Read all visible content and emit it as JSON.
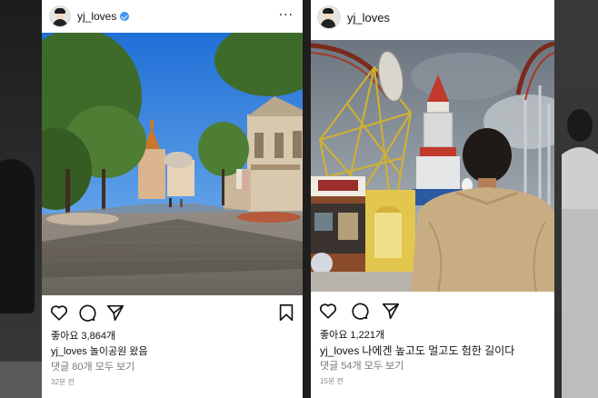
{
  "posts": [
    {
      "username": "yj_loves",
      "verified": true,
      "likes": "좋아요 3,864개",
      "caption_user": "yj_loves",
      "caption_text": "놀이공원 왔음",
      "comments": "댓글 80개 모두 보기",
      "time": "32분 전",
      "icons": [
        "heart-icon",
        "comment-icon",
        "share-icon",
        "bookmark-icon",
        "more-icon"
      ]
    },
    {
      "username": "yj_loves",
      "verified": false,
      "likes": "좋아요 1,221개",
      "caption_user": "yj_loves",
      "caption_text": "나에겐 높고도 멀고도 험한 길이다",
      "comments": "댓글 54개 모두 보기",
      "time": "15분 전",
      "icons": [
        "heart-icon",
        "comment-icon",
        "share-icon"
      ]
    }
  ],
  "more_glyph": "···",
  "colors": {
    "verified": "#3897f0",
    "text": "#111111",
    "muted": "#777777"
  }
}
